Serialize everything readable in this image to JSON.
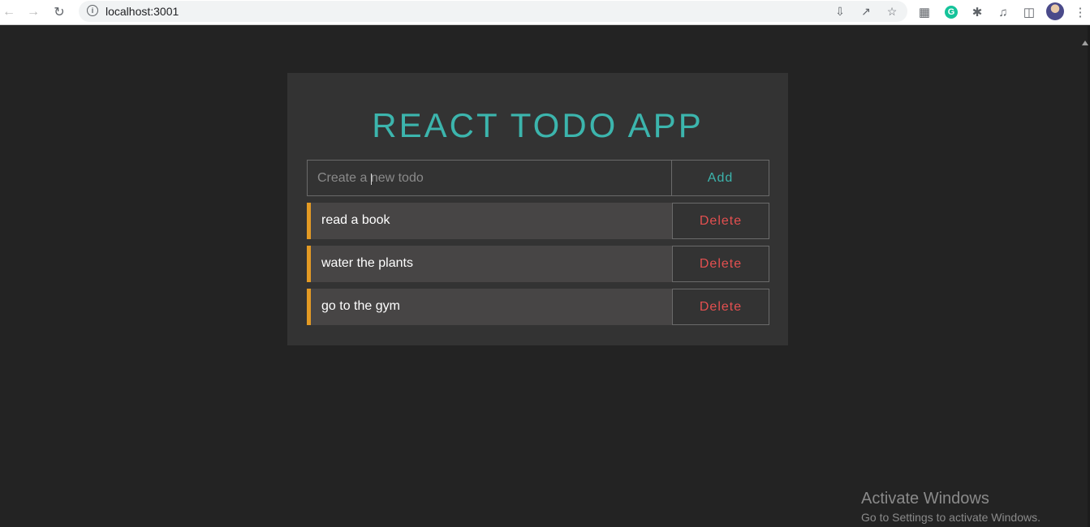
{
  "browser": {
    "url": "localhost:3001",
    "icons": [
      "back-icon",
      "forward-icon",
      "reload-icon",
      "info-icon",
      "install-icon",
      "share-icon",
      "bookmark-star-icon",
      "extension-icon",
      "grammarly-icon",
      "puzzle-icon",
      "media-icon",
      "side-panel-icon",
      "profile-avatar",
      "menu-icon"
    ]
  },
  "app": {
    "title": "REACT TODO APP",
    "input": {
      "placeholder": "Create a new todo",
      "value": ""
    },
    "add_label": "Add",
    "todos": [
      {
        "text": "read a book",
        "delete_label": "Delete"
      },
      {
        "text": "water the plants",
        "delete_label": "Delete"
      },
      {
        "text": "go to the gym",
        "delete_label": "Delete"
      }
    ],
    "colors": {
      "accent": "#3cb5ad",
      "delete": "#e45050",
      "todo_marker": "#e39a24",
      "background": "#232323",
      "card": "#333333"
    }
  },
  "watermark": {
    "line1": "Activate Windows",
    "line2": "Go to Settings to activate Windows."
  }
}
